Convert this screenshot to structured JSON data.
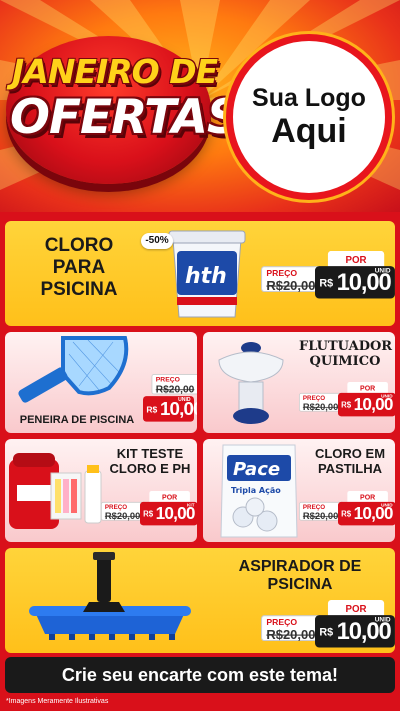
{
  "header": {
    "title_line1": "JANEIRO DE",
    "title_line2": "OFERTAS",
    "logo_line1": "Sua Logo",
    "logo_line2": "Aqui"
  },
  "products": [
    {
      "name": "CLORO PARA PSICINA",
      "badge": "-50%",
      "preco_label": "PREÇO",
      "old_price": "R$20,00",
      "por_label": "POR",
      "currency": "R$",
      "price": "10,00",
      "unit": "UNID"
    },
    {
      "name": "PENEIRA DE PISCINA",
      "preco_label": "PREÇO",
      "old_price": "R$20,00",
      "por_label": "POR",
      "currency": "R$",
      "price": "10,00",
      "unit": "UNID"
    },
    {
      "name": "FLUTUADOR QUIMICO",
      "preco_label": "PREÇO",
      "old_price": "R$20,00",
      "por_label": "POR",
      "currency": "R$",
      "price": "10,00",
      "unit": "UNID"
    },
    {
      "name": "KIT TESTE CLORO E PH",
      "preco_label": "PREÇO",
      "old_price": "R$20,00",
      "por_label": "POR",
      "currency": "R$",
      "price": "10,00",
      "unit": "KIT"
    },
    {
      "name": "CLORO EM PASTILHA",
      "preco_label": "PREÇO",
      "old_price": "R$20,00",
      "por_label": "POR",
      "currency": "R$",
      "price": "10,00",
      "unit": "UNID"
    },
    {
      "name": "ASPIRADOR DE PSICINA",
      "preco_label": "PREÇO",
      "old_price": "R$20,00",
      "por_label": "POR",
      "currency": "R$",
      "price": "10,00",
      "unit": "UNID"
    }
  ],
  "product_art": {
    "hth_brand": "hth",
    "pace_brand": "Pace",
    "pace_sub": "Tripla Ação"
  },
  "footer": {
    "cta": "Crie seu encarte com este tema!",
    "note": "*Imagens Meramente Ilustrativas"
  },
  "colors": {
    "red": "#d9101a",
    "yellow": "#ffc01a",
    "dark": "#1a1a1a",
    "pink": "#f9c9cc"
  }
}
